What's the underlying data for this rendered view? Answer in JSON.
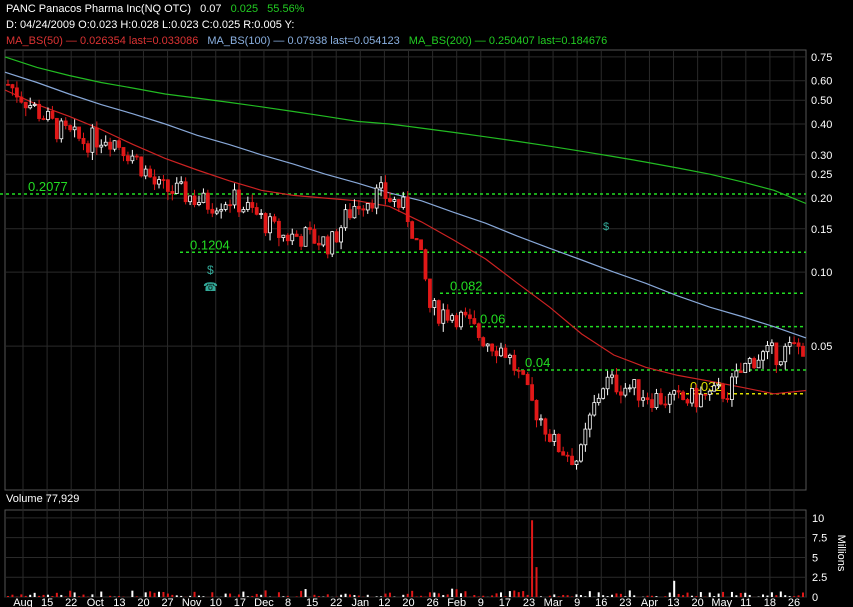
{
  "header": {
    "line1": {
      "symbol": "PANC Panacos Pharma Inc(NQ OTC)",
      "last": "0.07",
      "change": "0.025",
      "pct": "55.56%"
    },
    "line2": "D: 04/24/2009 O:0.023 H:0.028 L:0.023 C:0.025 R:0.005 Y:",
    "ma50": "MA_BS(50) — 0.026354 last=0.033086",
    "ma100": "MA_BS(100) — 0.07938 last=0.054123",
    "ma200": "MA_BS(200) — 0.250407 last=0.184676",
    "volume": "Volume 77,929"
  },
  "colors": {
    "ma50": "#cc2222",
    "ma100": "#88a8d8",
    "ma200": "#22bb22",
    "up": "#ffffff",
    "down": "#e01818",
    "level": "#22dd22",
    "level_yellow": "#dddd00",
    "grid": "#2a2a2a"
  },
  "chart_data": {
    "type": "candlestick",
    "price_scale": "log",
    "ylim": [
      0.013,
      0.8
    ],
    "y_ticks": [
      "0.75",
      "0.60",
      "0.50",
      "0.40",
      "0.30",
      "0.25",
      "0.20",
      "0.15",
      "0.10",
      "0.05"
    ],
    "vol_ticks": [
      "10",
      "7.5",
      "5",
      "2.5",
      "0"
    ],
    "vol_unit": "Millions",
    "x_labels": [
      "Aug",
      "15",
      "22",
      "Oct",
      "13",
      "20",
      "27",
      "Nov",
      "10",
      "17",
      "Dec",
      "8",
      "15",
      "22",
      "Jan",
      "12",
      "20",
      "26",
      "Feb",
      "9",
      "17",
      "23",
      "Mar",
      "9",
      "16",
      "23",
      "Apr",
      "13",
      "20",
      "May",
      "11",
      "18",
      "26"
    ],
    "levels": [
      {
        "label": "0.2077",
        "value": 0.2077
      },
      {
        "label": "0.1204",
        "value": 0.1204
      },
      {
        "label": "0.082",
        "value": 0.082
      },
      {
        "label": "0.06",
        "value": 0.06
      },
      {
        "label": "0.04",
        "value": 0.04
      },
      {
        "label": "0.032",
        "value": 0.032
      }
    ],
    "ma200": [
      0.75,
      0.68,
      0.63,
      0.59,
      0.56,
      0.53,
      0.51,
      0.49,
      0.47,
      0.45,
      0.43,
      0.41,
      0.4,
      0.385,
      0.37,
      0.355,
      0.34,
      0.325,
      0.31,
      0.295,
      0.28,
      0.265,
      0.25,
      0.233,
      0.215,
      0.19
    ],
    "ma100": [
      0.65,
      0.59,
      0.53,
      0.48,
      0.44,
      0.4,
      0.36,
      0.33,
      0.3,
      0.275,
      0.25,
      0.23,
      0.21,
      0.195,
      0.175,
      0.158,
      0.14,
      0.125,
      0.112,
      0.1,
      0.09,
      0.08,
      0.072,
      0.066,
      0.06,
      0.054
    ],
    "ma50": [
      0.55,
      0.48,
      0.43,
      0.38,
      0.33,
      0.29,
      0.26,
      0.235,
      0.215,
      0.205,
      0.2,
      0.195,
      0.185,
      0.16,
      0.135,
      0.113,
      0.09,
      0.072,
      0.056,
      0.046,
      0.041,
      0.038,
      0.036,
      0.034,
      0.032,
      0.033
    ]
  }
}
